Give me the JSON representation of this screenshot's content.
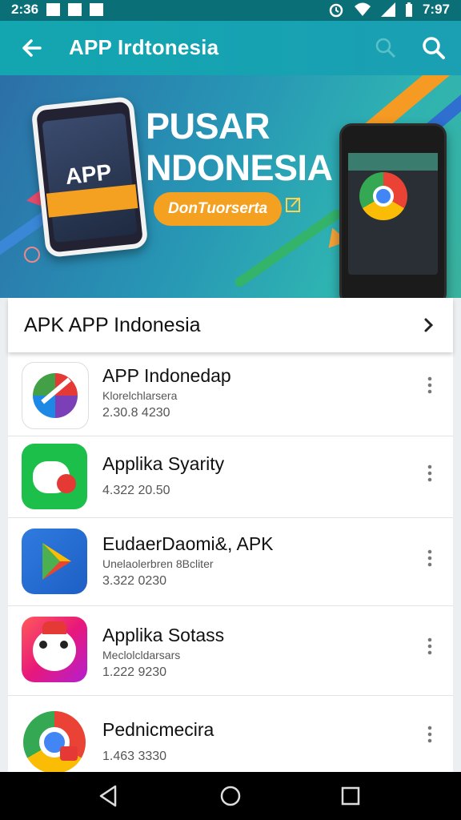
{
  "status_bar": {
    "left_time": "2:36",
    "right_time": "7:97"
  },
  "app_bar": {
    "title": "APP Irdtonesia",
    "back_icon": "back-arrow-icon",
    "search_icon": "search-icon"
  },
  "banner": {
    "headline_line1": "PUSAR",
    "headline_line2": "NDONESIA",
    "pill_text": "DonTuorserta",
    "phone_word": "APP"
  },
  "section": {
    "title": "APK APP Indonesia",
    "chevron_icon": "chevron-right-icon"
  },
  "apps": [
    {
      "name": "APP Indonedap",
      "subtitle": "Klorelchlarsera",
      "version": "2.30.8  4230",
      "icon": "pinwheel-icon"
    },
    {
      "name": "Applika Syarity",
      "subtitle": "",
      "version": "4.322  20.50",
      "icon": "green-chat-icon"
    },
    {
      "name": "EudaerDaomi&, APK",
      "subtitle": "Unelaolerbren 8Bcliter",
      "version": "3.322  0230",
      "icon": "play-store-icon"
    },
    {
      "name": "Applika Sotass",
      "subtitle": "Meclolcldarsars",
      "version": "1.222  9230",
      "icon": "mascot-face-icon"
    },
    {
      "name": "Pednicmecira",
      "subtitle": "",
      "version": "1.463  3330",
      "icon": "chrome-icon"
    }
  ],
  "nav": {
    "back": "nav-back-icon",
    "home": "nav-home-icon",
    "recents": "nav-recents-icon"
  },
  "colors": {
    "app_bar": "#13a6b0",
    "status_bar": "#0b6f78",
    "accent_orange": "#f4a020"
  }
}
